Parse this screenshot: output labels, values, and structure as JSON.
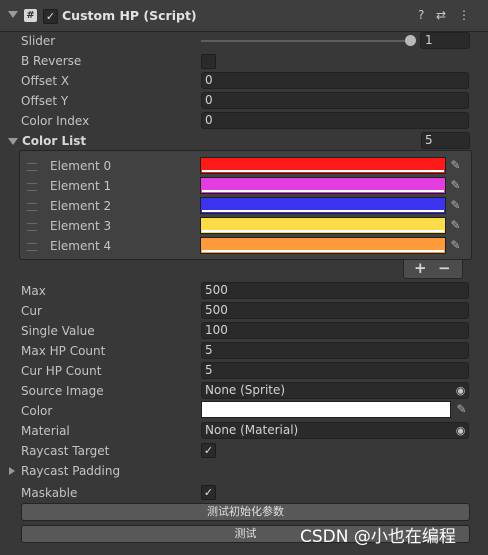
{
  "component": {
    "title": "Custom HP (Script)",
    "script_icon": "#",
    "enabled_checkmark": "✓",
    "help_icon": "?",
    "settings_icon": "⇄",
    "menu_icon": "⋮"
  },
  "fields": {
    "slider_label": "Slider",
    "slider_value": "1",
    "slider_level": 1,
    "b_reverse_label": "B Reverse",
    "offset_x_label": "Offset X",
    "offset_x_value": "0",
    "offset_y_label": "Offset Y",
    "offset_y_value": "0",
    "color_index_label": "Color Index",
    "color_index_value": "0"
  },
  "color_list": {
    "label": "Color List",
    "size": "5",
    "elements": [
      {
        "label": "Element 0",
        "color": "#ff1a1a"
      },
      {
        "label": "Element 1",
        "color": "#e33de0"
      },
      {
        "label": "Element 2",
        "color": "#3b33f0"
      },
      {
        "label": "Element 3",
        "color": "#fddc49"
      },
      {
        "label": "Element 4",
        "color": "#ff9a3a"
      }
    ],
    "add": "+",
    "remove": "−",
    "picker_icon": "✎"
  },
  "stats": {
    "max_label": "Max",
    "max_value": "500",
    "cur_label": "Cur",
    "cur_value": "500",
    "single_label": "Single Value",
    "single_value": "100",
    "max_hp_count_label": "Max HP Count",
    "max_hp_count_value": "5",
    "cur_hp_count_label": "Cur HP Count",
    "cur_hp_count_value": "5"
  },
  "image": {
    "source_image_label": "Source Image",
    "source_image_value": "None (Sprite)",
    "color_label": "Color",
    "color_value": "#ffffff",
    "material_label": "Material",
    "material_value": "None (Material)",
    "raycast_target_label": "Raycast Target",
    "raycast_target_check": "✓",
    "raycast_padding_label": "Raycast Padding",
    "maskable_label": "Maskable",
    "maskable_check": "✓",
    "object_picker_icon": "◉"
  },
  "buttons": {
    "init_params": "测试初始化参数",
    "test": "测试"
  },
  "watermark": "CSDN @小也在编程"
}
